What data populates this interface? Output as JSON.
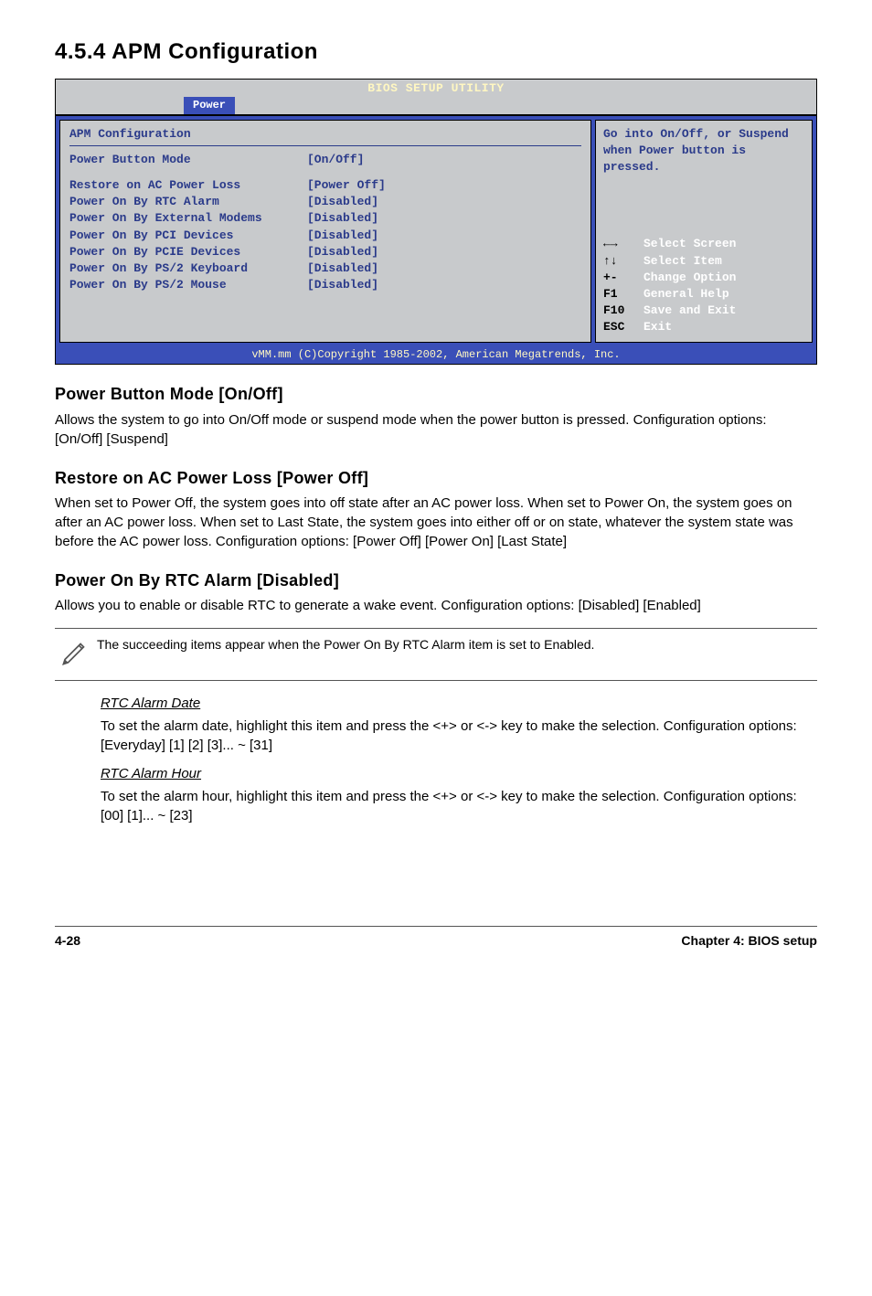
{
  "heading": "4.5.4   APM Configuration",
  "bios": {
    "title": "BIOS SETUP UTILITY",
    "tab": "Power",
    "section_title": "APM Configuration",
    "rows": [
      {
        "label": "Power Button Mode",
        "value": "[On/Off]"
      },
      {
        "label": "Restore on AC Power Loss",
        "value": "[Power Off]"
      },
      {
        "label": "Power On By RTC Alarm",
        "value": "[Disabled]"
      },
      {
        "label": "Power On By External Modems",
        "value": "[Disabled]"
      },
      {
        "label": "Power On By PCI Devices",
        "value": "[Disabled]"
      },
      {
        "label": "Power On By PCIE Devices",
        "value": "[Disabled]"
      },
      {
        "label": "Power On By PS/2 Keyboard",
        "value": "[Disabled]"
      },
      {
        "label": "Power On By PS/2 Mouse",
        "value": "[Disabled]"
      }
    ],
    "help": "Go into On/Off, or Suspend when Power button is pressed.",
    "keys": [
      {
        "sym": "←→",
        "txt": "Select Screen"
      },
      {
        "sym": "↑↓",
        "txt": "Select Item"
      },
      {
        "sym": "+-",
        "txt": "Change Option"
      },
      {
        "sym": "F1",
        "txt": "General Help"
      },
      {
        "sym": "F10",
        "txt": "Save and Exit"
      },
      {
        "sym": "ESC",
        "txt": "Exit"
      }
    ],
    "footer": "vMM.mm (C)Copyright 1985-2002, American Megatrends, Inc."
  },
  "s1": {
    "h": "Power Button Mode [On/Off]",
    "p": "Allows the system to go into On/Off mode or suspend mode when the power button is pressed. Configuration options: [On/Off] [Suspend]"
  },
  "s2": {
    "h": "Restore on AC Power Loss [Power Off]",
    "p": "When set to Power Off, the system goes into off state after an AC power loss. When set to Power On, the system goes on after an AC power loss. When set to Last State, the system goes into either off or on state, whatever the system state was before the AC power loss. Configuration options: [Power Off] [Power On] [Last State]"
  },
  "s3": {
    "h": "Power On By RTC Alarm [Disabled]",
    "p": "Allows you to enable or disable RTC to generate a wake event. Configuration options: [Disabled] [Enabled]"
  },
  "note": "The succeeding items appear when the Power On By RTC Alarm item is set to Enabled.",
  "rtc_date": {
    "h": "RTC Alarm Date",
    "p": "To set the alarm date, highlight this item and press the <+> or <-> key to make the selection. Configuration options: [Everyday] [1] [2] [3]... ~ [31]"
  },
  "rtc_hour": {
    "h": "RTC Alarm Hour",
    "p": "To set the alarm hour, highlight this item and press the <+> or <-> key to make the selection. Configuration options: [00] [1]... ~ [23]"
  },
  "footer": {
    "left": "4-28",
    "right": "Chapter 4: BIOS setup"
  }
}
